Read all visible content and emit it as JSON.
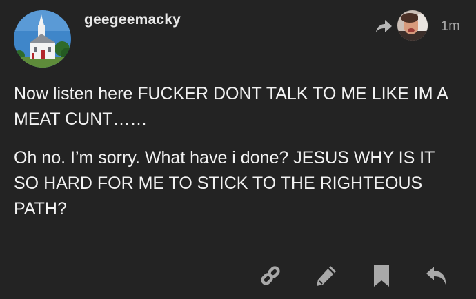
{
  "post": {
    "username": "geegeemacky",
    "timestamp": "1m",
    "paragraphs": [
      "Now listen here FUCKER DONT TALK TO ME LIKE IM A MEAT CUNT……",
      "Oh no. I’m sorry. What have i done? JESUS WHY IS IT SO HARD FOR ME TO STICK TO THE RIGHTEOUS PATH?"
    ]
  },
  "icons": {
    "reply_indicator": "share-arrow-icon",
    "link": "link-icon",
    "edit": "pencil-icon",
    "bookmark": "bookmark-icon",
    "reply": "reply-icon"
  },
  "colors": {
    "background": "#232323",
    "text": "#f2f2f2",
    "muted": "#a7a7a7",
    "icon": "#a9a9a9"
  }
}
